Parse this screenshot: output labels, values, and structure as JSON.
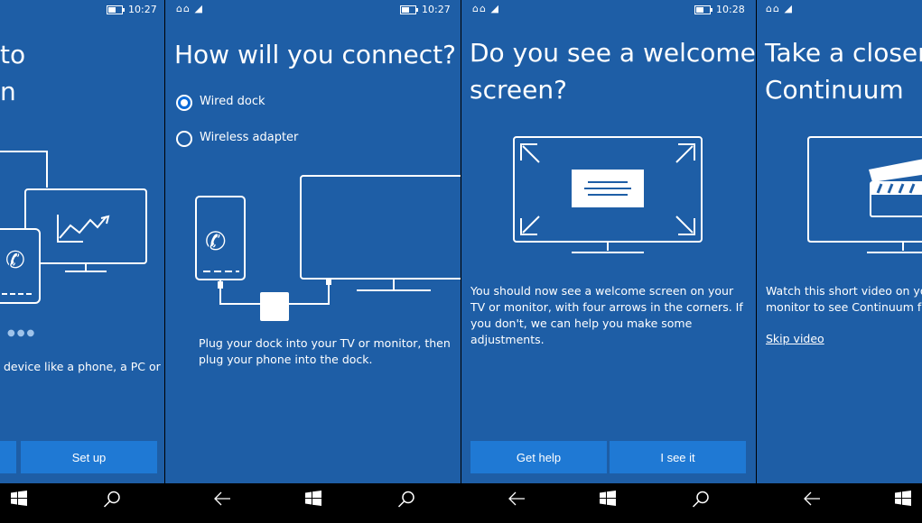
{
  "panels": [
    {
      "time": "10:27",
      "title_lines": [
        "to",
        "n"
      ],
      "body": "device like a phone, a PC or",
      "button": "Set up"
    },
    {
      "time": "10:27",
      "title": "How will you connect?",
      "options": [
        {
          "label": "Wired dock",
          "selected": true
        },
        {
          "label": "Wireless adapter",
          "selected": false
        }
      ],
      "body": "Plug your dock into your TV or monitor, then plug your phone into the dock."
    },
    {
      "time": "10:28",
      "title_lines": [
        "Do you see a welcome",
        "screen?"
      ],
      "body": "You should now see a welcome screen on your TV or monitor, with four arrows in the corners. If you don't, we can help you make some adjustments.",
      "buttons": [
        "Get help",
        "I see it"
      ]
    },
    {
      "title_lines": [
        "Take a closer l",
        "Continuum"
      ],
      "body_lines": [
        "Watch this short video on you",
        "monitor to see Continuum fo"
      ],
      "link": "Skip video"
    }
  ],
  "nav_icons": [
    "back-icon",
    "windows-icon",
    "search-icon"
  ],
  "colors": {
    "panel": "#1e5ea6",
    "button": "#1f79d4",
    "navbar": "#000000"
  }
}
